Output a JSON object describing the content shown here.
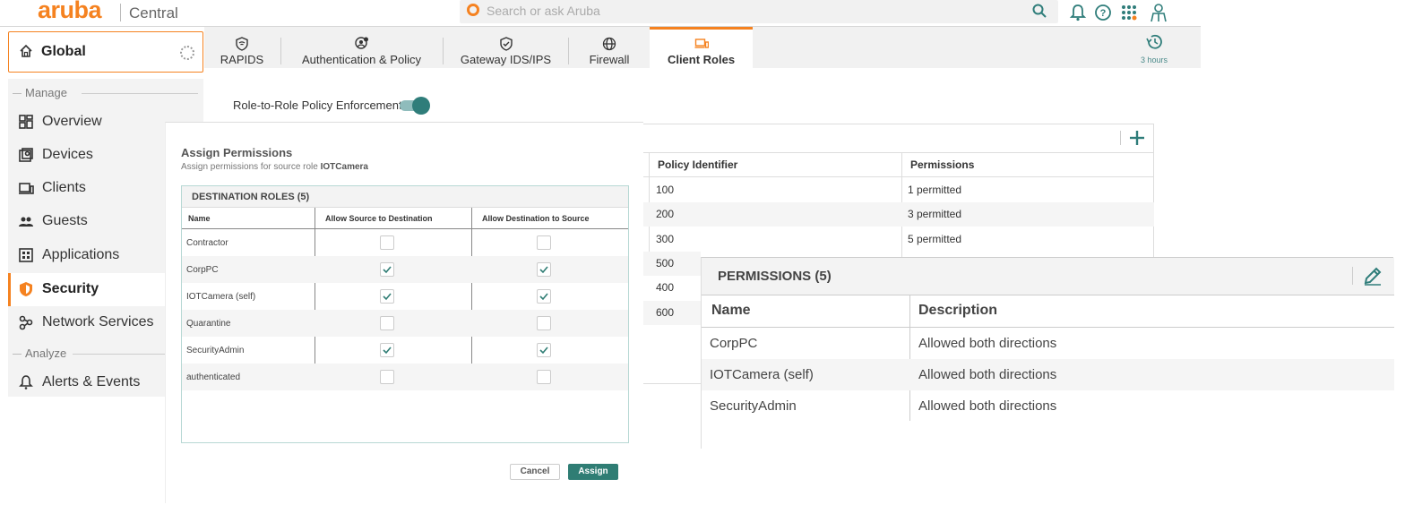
{
  "header": {
    "logo": "aruba",
    "app_name": "Central",
    "search_placeholder": "Search or ask Aruba",
    "brand_color": "#f58220"
  },
  "scope": {
    "label": "Global"
  },
  "nav": {
    "sections": [
      {
        "label": "Manage"
      },
      {
        "label": "Analyze"
      }
    ],
    "items": [
      {
        "label": "Overview",
        "icon": "grid-icon"
      },
      {
        "label": "Devices",
        "icon": "devices-icon"
      },
      {
        "label": "Clients",
        "icon": "clients-icon"
      },
      {
        "label": "Guests",
        "icon": "guests-icon"
      },
      {
        "label": "Applications",
        "icon": "applications-icon"
      },
      {
        "label": "Security",
        "icon": "shield-icon",
        "active": true
      },
      {
        "label": "Network Services",
        "icon": "network-services-icon"
      },
      {
        "label": "Alerts & Events",
        "icon": "bell-icon"
      }
    ]
  },
  "tabs": [
    {
      "label": "RAPIDS",
      "icon": "rapids-icon"
    },
    {
      "label": "Authentication & Policy",
      "icon": "auth-policy-icon"
    },
    {
      "label": "Gateway IDS/IPS",
      "icon": "gateway-shield-icon"
    },
    {
      "label": "Firewall",
      "icon": "globe-icon"
    },
    {
      "label": "Client Roles",
      "icon": "client-roles-icon",
      "active": true
    }
  ],
  "time_filter": {
    "label": "3 hours"
  },
  "policy_toggle": {
    "label": "Role-to-Role Policy Enforcement",
    "enabled": true
  },
  "roles_table": {
    "columns": [
      "Policy Identifier",
      "Permissions"
    ],
    "rows": [
      {
        "id": "100",
        "permissions": "1 permitted"
      },
      {
        "id": "200",
        "permissions": "3 permitted"
      },
      {
        "id": "300",
        "permissions": "5 permitted"
      },
      {
        "id": "500",
        "permissions": ""
      },
      {
        "id": "400",
        "permissions": ""
      },
      {
        "id": "600",
        "permissions": ""
      }
    ]
  },
  "assign_modal": {
    "title": "Assign Permissions",
    "subtitle_prefix": "Assign permissions for source role",
    "source_role": "IOTCamera",
    "table_title": "DESTINATION ROLES (5)",
    "columns": [
      "Name",
      "Allow Source to Destination",
      "Allow Destination to Source"
    ],
    "rows": [
      {
        "name": "Contractor",
        "src_to_dst": false,
        "dst_to_src": false
      },
      {
        "name": "CorpPC",
        "src_to_dst": true,
        "dst_to_src": true
      },
      {
        "name": "IOTCamera (self)",
        "src_to_dst": true,
        "dst_to_src": true
      },
      {
        "name": "Quarantine",
        "src_to_dst": false,
        "dst_to_src": false
      },
      {
        "name": "SecurityAdmin",
        "src_to_dst": true,
        "dst_to_src": true
      },
      {
        "name": "authenticated",
        "src_to_dst": false,
        "dst_to_src": false
      }
    ],
    "cancel_label": "Cancel",
    "assign_label": "Assign",
    "accent_color": "#2f7d74"
  },
  "permissions_panel": {
    "title": "PERMISSIONS (5)",
    "columns": [
      "Name",
      "Description"
    ],
    "rows": [
      {
        "name": "CorpPC",
        "description": "Allowed both directions"
      },
      {
        "name": "IOTCamera (self)",
        "description": "Allowed both directions"
      },
      {
        "name": "SecurityAdmin",
        "description": "Allowed both directions"
      }
    ]
  }
}
